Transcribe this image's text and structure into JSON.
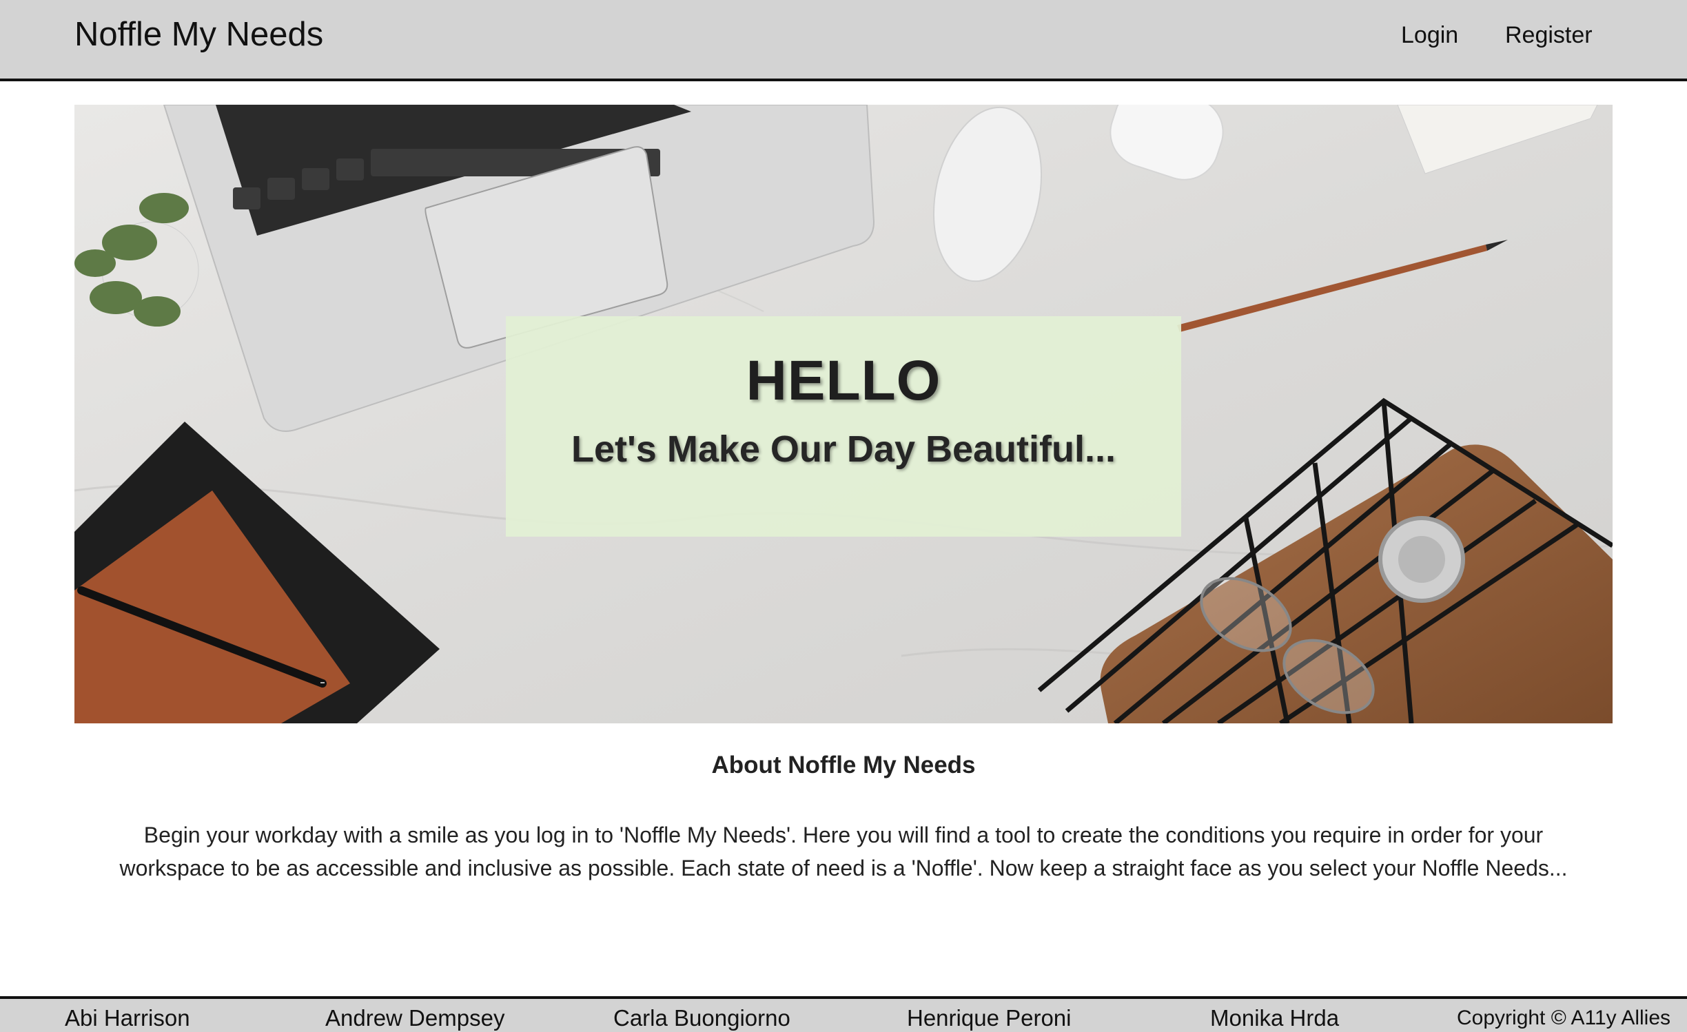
{
  "header": {
    "brand": "Noffle My Needs",
    "nav": {
      "login": "Login",
      "register": "Register"
    }
  },
  "hero": {
    "title": "HELLO",
    "subtitle": "Let's Make Our Day Beautiful..."
  },
  "about": {
    "title": "About Noffle My Needs",
    "text": "Begin your workday with a smile as you log in to 'Noffle My Needs'. Here you will find a tool to create the conditions you require in order for your workspace to be as accessible and inclusive as possible. Each state of need is a 'Noffle'. Now keep a straight face as you select your Noffle Needs..."
  },
  "footer": {
    "names": [
      "Abi Harrison",
      "Andrew Dempsey",
      "Carla Buongiorno",
      "Henrique Peroni",
      "Monika Hrda"
    ],
    "copyright": "Copyright © A11y Allies"
  },
  "colors": {
    "navbar_bg": "#d3d3d3",
    "hero_box_bg": "#e2f0d4",
    "text": "#1c1c1c"
  }
}
